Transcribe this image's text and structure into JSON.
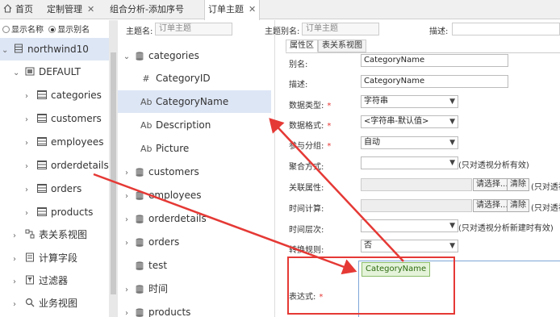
{
  "tabs": [
    {
      "label": "首页",
      "closable": false
    },
    {
      "label": "定制管理",
      "closable": true
    },
    {
      "label": "组合分析-添加序号",
      "closable": false
    },
    {
      "label": "订单主题",
      "closable": true,
      "active": true
    }
  ],
  "left": {
    "radio_show_name": "显示名称",
    "radio_show_alias": "显示别名",
    "root": "northwind10",
    "schema": "DEFAULT",
    "tables": [
      "categories",
      "customers",
      "employees",
      "orderdetails",
      "orders",
      "products"
    ],
    "sections": [
      "表关系视图",
      "计算字段",
      "过滤器",
      "业务视图"
    ]
  },
  "middle": {
    "topic_label": "主题名:",
    "topic_placeholder": "订单主题",
    "expanded_table": "categories",
    "fields": [
      {
        "type": "#",
        "name": "CategoryID"
      },
      {
        "type": "Ab",
        "name": "CategoryName"
      },
      {
        "type": "Ab",
        "name": "Description"
      },
      {
        "type": "Ab",
        "name": "Picture"
      }
    ],
    "tables": [
      "customers",
      "employees",
      "orderdetails",
      "orders",
      "test",
      "时间",
      "products"
    ]
  },
  "right": {
    "alias_label": "主题别名:",
    "alias_value": "订单主题",
    "desc_label": "描述:",
    "subtabs": [
      "属性区",
      "表关系视图"
    ],
    "form": {
      "alias_label": "别名:",
      "alias_value": "CategoryName",
      "desc_label": "描述:",
      "desc_value": "CategoryName",
      "datatype_label": "数据类型:",
      "datatype_value": "字符串",
      "format_label": "数据格式:",
      "format_value": "<字符串-默认值>",
      "group_label": "参与分组:",
      "group_value": "自动",
      "agg_label": "聚合方式:",
      "agg_note": "(只对透视分析有效)",
      "assoc_label": "关联属性:",
      "select_btn": "请选择...",
      "clear_btn": "清除",
      "assoc_note": "(只对透视",
      "timecalc_label": "时间计算:",
      "timecalc_note": "(只对透视",
      "timelevel_label": "时间层次:",
      "timelevel_note": "(只对透视分析新建时有效)",
      "convert_label": "转换规则:",
      "convert_value": "否",
      "expr_label": "表达式:",
      "expr_chip": "CategoryName"
    }
  },
  "colors": {
    "selection": "#dde6f5",
    "annotation_red": "#e53935",
    "chip_green": "#e4f3d9"
  }
}
